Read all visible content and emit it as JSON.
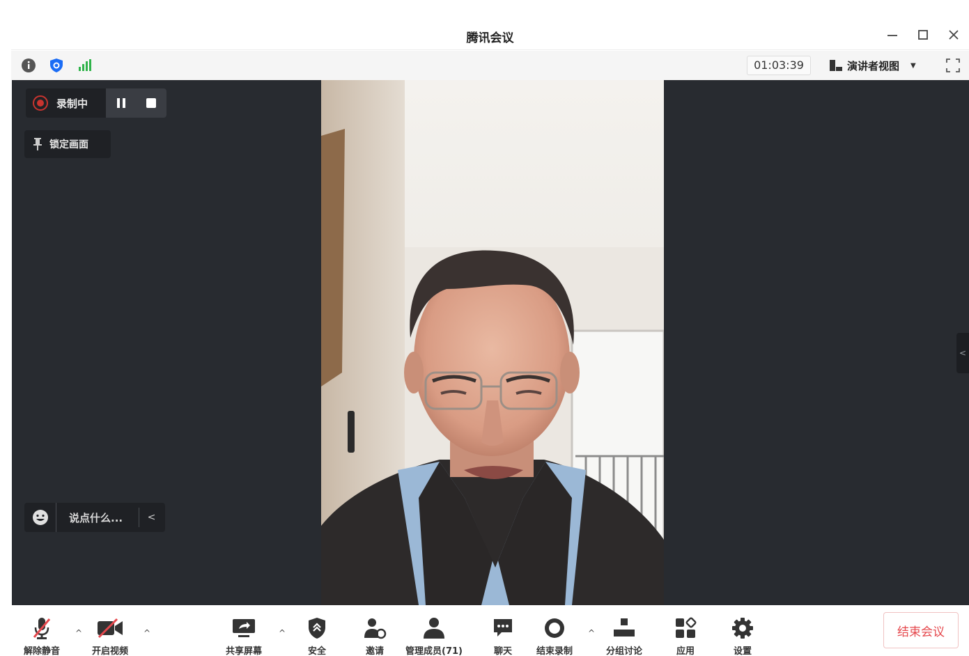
{
  "window": {
    "title": "腾讯会议"
  },
  "infobar": {
    "timer": "01:03:39",
    "view_mode_label": "演讲者视图",
    "icons": [
      "info-icon",
      "shield-icon",
      "signal-icon",
      "speaker-view-icon",
      "fullscreen-icon"
    ]
  },
  "stage": {
    "recording_label": "录制中",
    "lock_screen_label": "锁定画面",
    "chat_placeholder": "说点什么...",
    "chat_collapse_glyph": "<",
    "side_handle_glyph": "<"
  },
  "toolbar": {
    "unmute_label": "解除静音",
    "start_video_label": "开启视频",
    "share_screen_label": "共享屏幕",
    "security_label": "安全",
    "invite_label": "邀请",
    "manage_members_label": "管理成员(71)",
    "chat_label": "聊天",
    "end_recording_label": "结束录制",
    "breakout_label": "分组讨论",
    "apps_label": "应用",
    "settings_label": "设置",
    "end_meeting_label": "结束会议",
    "caret_glyph": "^"
  },
  "colors": {
    "stage_bg": "#282b30",
    "record_red": "#c9342f",
    "end_red": "#e5484d",
    "brand_blue": "#1a6cf5",
    "signal_green": "#2fb34a"
  }
}
